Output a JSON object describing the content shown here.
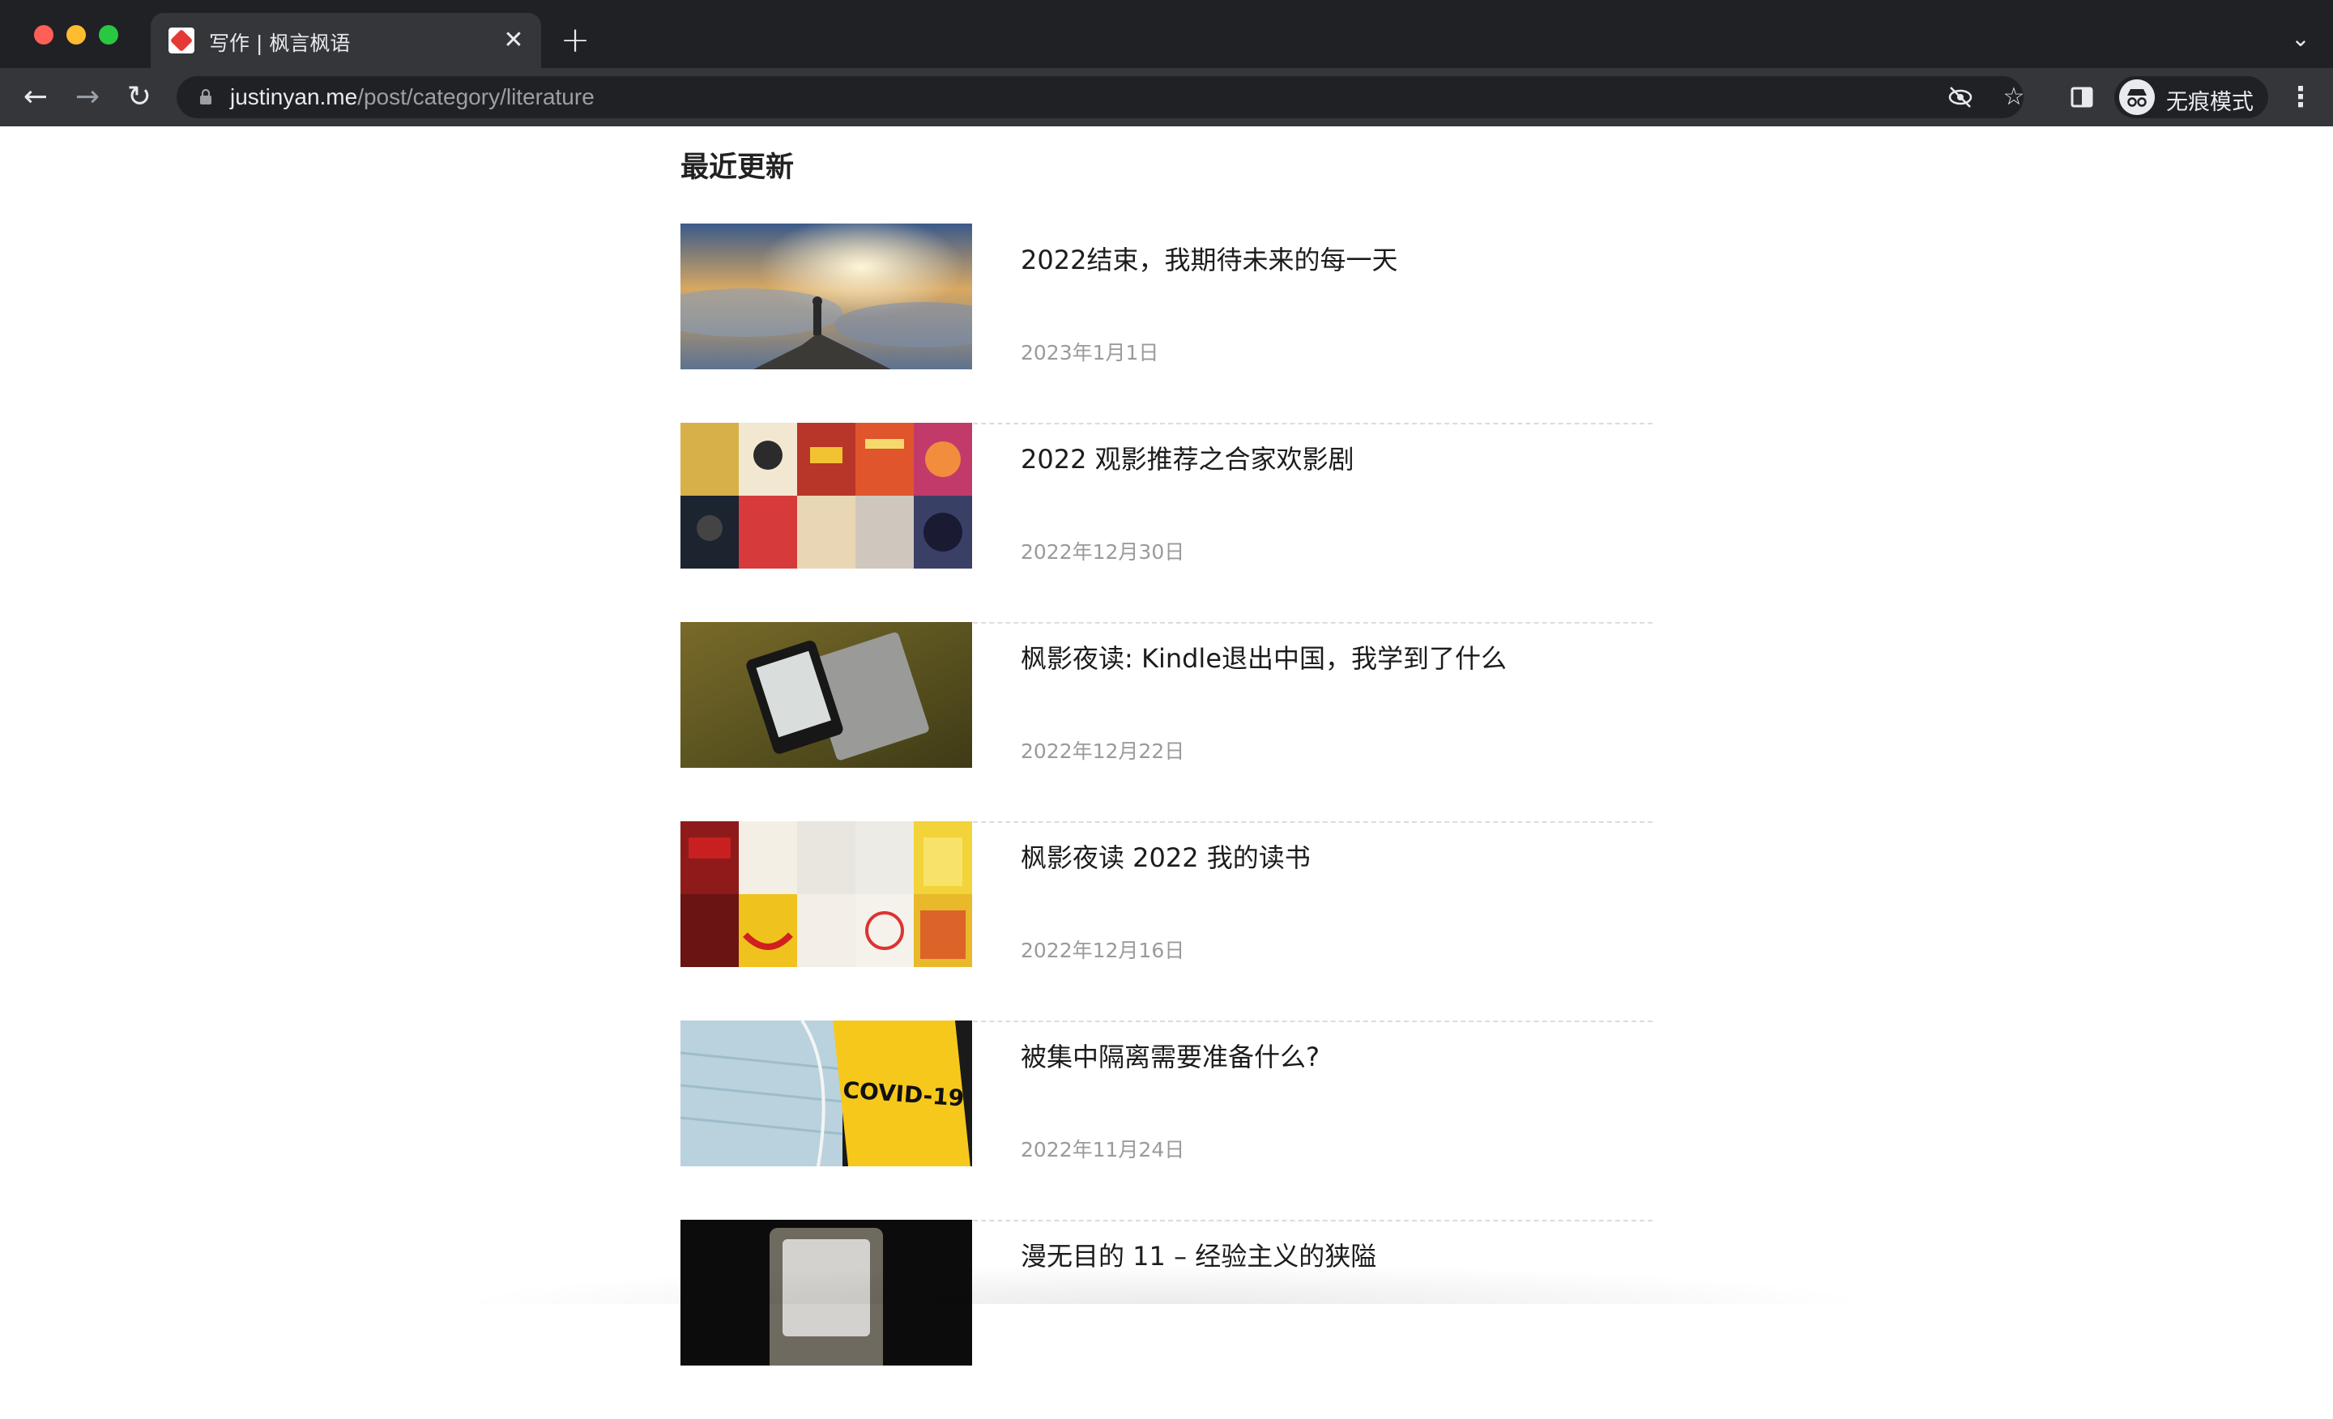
{
  "browser": {
    "tab_title": "写作 | 枫言枫语",
    "url_host": "justinyan.me",
    "url_path": "/post/category/literature",
    "incognito_label": "无痕模式"
  },
  "page": {
    "section_title": "最近更新",
    "posts": [
      {
        "title": "2022结束，我期待未来的每一天",
        "date": "2023年1月1日",
        "thumb": "landscape-hero"
      },
      {
        "title": "2022 观影推荐之合家欢影剧",
        "date": "2022年12月30日",
        "thumb": "movie-posters-grid"
      },
      {
        "title": "枫影夜读: Kindle退出中国，我学到了什么",
        "date": "2022年12月22日",
        "thumb": "kindle-on-grass"
      },
      {
        "title": "枫影夜读 2022 我的读书",
        "date": "2022年12月16日",
        "thumb": "book-covers-grid"
      },
      {
        "title": "被集中隔离需要准备什么?",
        "date": "2022年11月24日",
        "thumb": "covid-mask",
        "thumb_text": "COVID-19"
      },
      {
        "title": "漫无目的 11 – 经验主义的狭隘",
        "date": "",
        "thumb": "old-tv"
      }
    ]
  },
  "colors": {
    "chrome_dark": "#202124",
    "chrome_toolbar": "#35363a",
    "text_primary": "#1c1c1c",
    "text_muted": "#9a9a9a",
    "divider": "#dcdcdc"
  }
}
